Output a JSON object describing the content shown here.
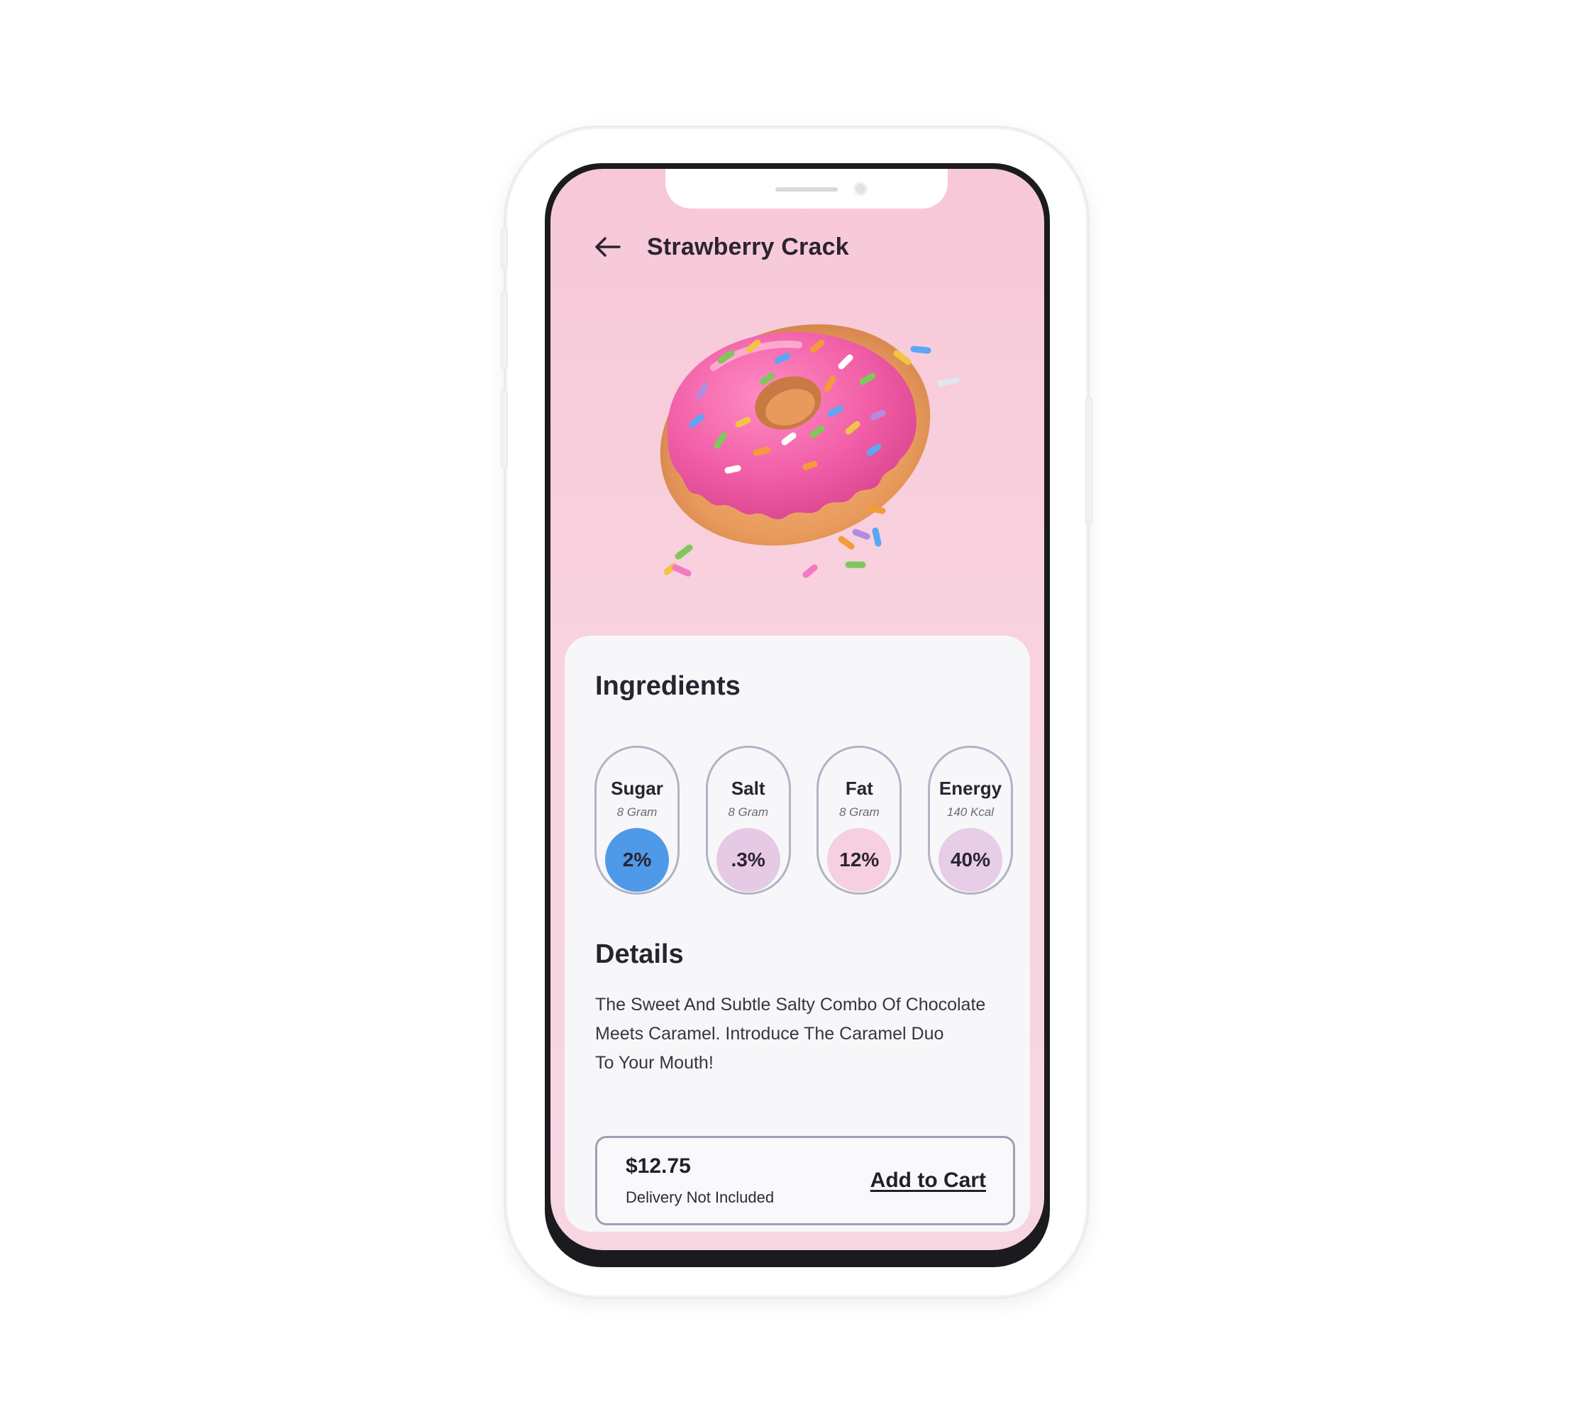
{
  "header": {
    "title": "Strawberry Crack"
  },
  "ingredients": {
    "heading": "Ingredients",
    "items": [
      {
        "name": "Sugar",
        "amount": "8 Gram",
        "percent": "2%",
        "color": "#4f9ae8"
      },
      {
        "name": "Salt",
        "amount": "8 Gram",
        "percent": ".3%",
        "color": "#e6c9e4"
      },
      {
        "name": "Fat",
        "amount": "8 Gram",
        "percent": "12%",
        "color": "#f6cfe0"
      },
      {
        "name": "Energy",
        "amount": "140 Kcal",
        "percent": "40%",
        "color": "#e7cde6"
      }
    ]
  },
  "details": {
    "heading": "Details",
    "line1": "The Sweet And Subtle Salty Combo Of Chocolate",
    "line2": "Meets Caramel. Introduce The Caramel Duo",
    "line3": "To Your Mouth!"
  },
  "cart": {
    "price": "$12.75",
    "delivery_note": "Delivery Not Included",
    "add_label": "Add to Cart"
  },
  "colors": {
    "background_pink": "#f7c8d8",
    "card": "#f7f7fa",
    "text_dark": "#2a2430"
  }
}
